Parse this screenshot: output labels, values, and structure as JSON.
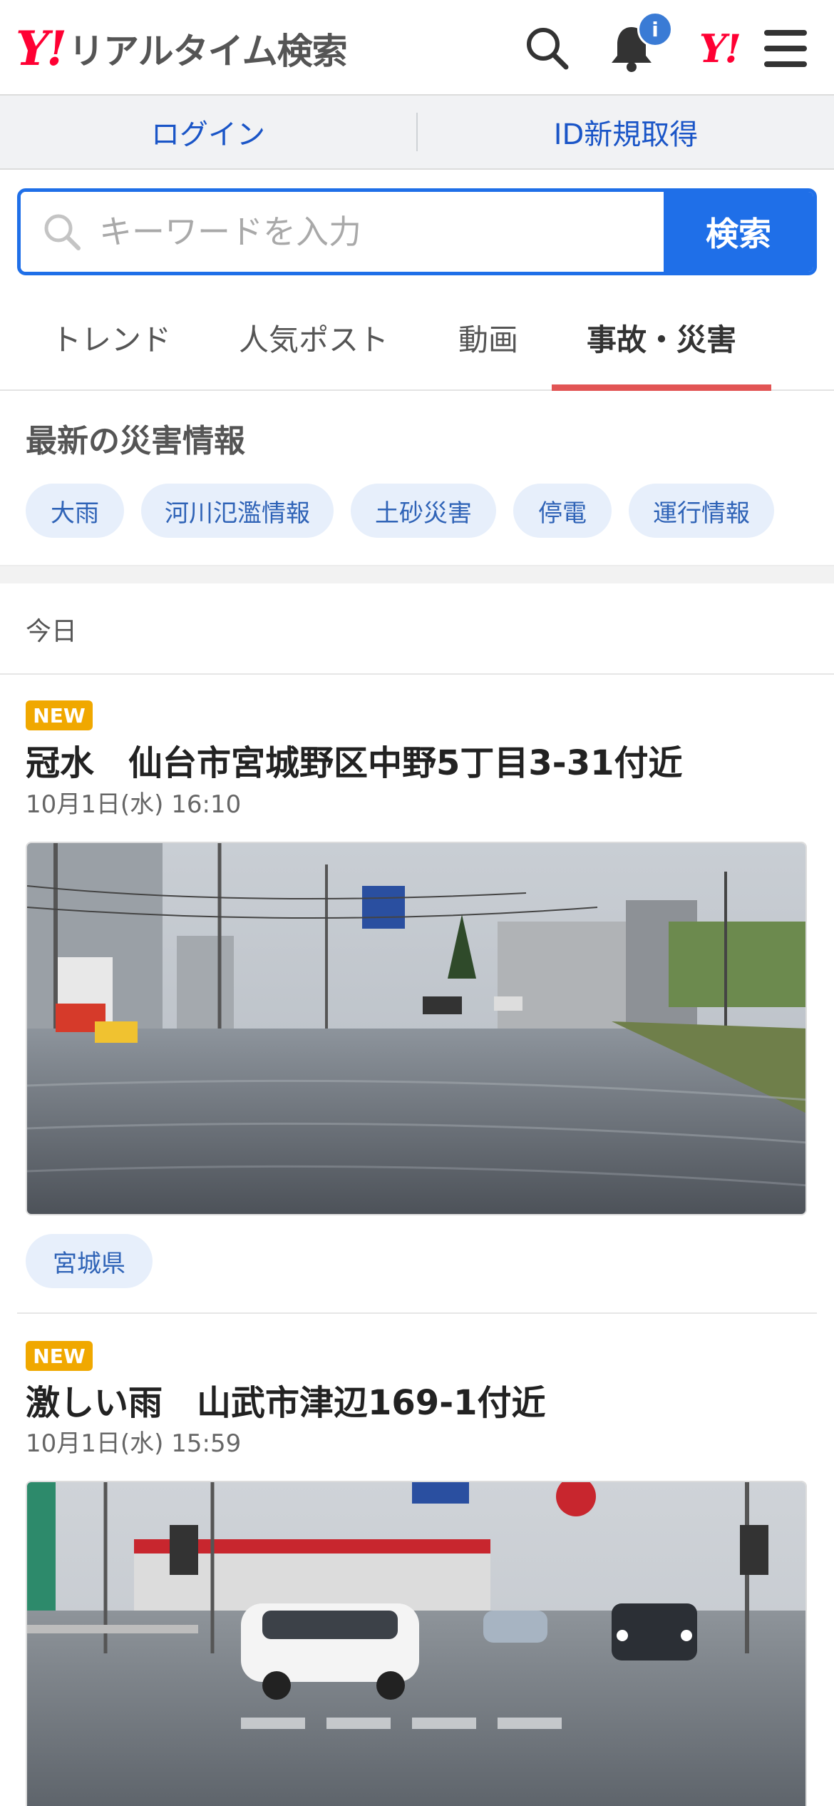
{
  "header": {
    "logo_mark": "Y!",
    "logo_text": "リアルタイム検索",
    "search_icon": "search-icon",
    "bell_icon": "bell-icon",
    "notification_badge": "i",
    "yahoo_logo": "Y!",
    "menu_icon": "hamburger-menu-icon"
  },
  "account": {
    "login_label": "ログイン",
    "signup_label": "ID新規取得"
  },
  "search": {
    "placeholder": "キーワードを入力",
    "button_label": "検索"
  },
  "tabs": [
    {
      "label": "トレンド",
      "active": false
    },
    {
      "label": "人気ポスト",
      "active": false
    },
    {
      "label": "動画",
      "active": false
    },
    {
      "label": "事故・災害",
      "active": true
    }
  ],
  "disaster_info": {
    "title": "最新の災害情報",
    "chips": [
      "大雨",
      "河川氾濫情報",
      "土砂災害",
      "停電",
      "運行情報"
    ]
  },
  "feed": {
    "section_label": "今日",
    "posts": [
      {
        "badge": "NEW",
        "title": "冠水　仙台市宮城野区中野5丁目3-31付近",
        "date": "10月1日(水) 16:10",
        "location_tag": "宮城県"
      },
      {
        "badge": "NEW",
        "title": "激しい雨　山武市津辺169-1付近",
        "date": "10月1日(水) 15:59"
      }
    ]
  },
  "colors": {
    "brand_red": "#ff0033",
    "accent_blue": "#1f6fe8",
    "link_blue": "#1a55c7",
    "chip_bg": "#e7effb",
    "chip_text": "#2f63b7",
    "tab_underline": "#e25555",
    "new_badge": "#f0a800"
  }
}
